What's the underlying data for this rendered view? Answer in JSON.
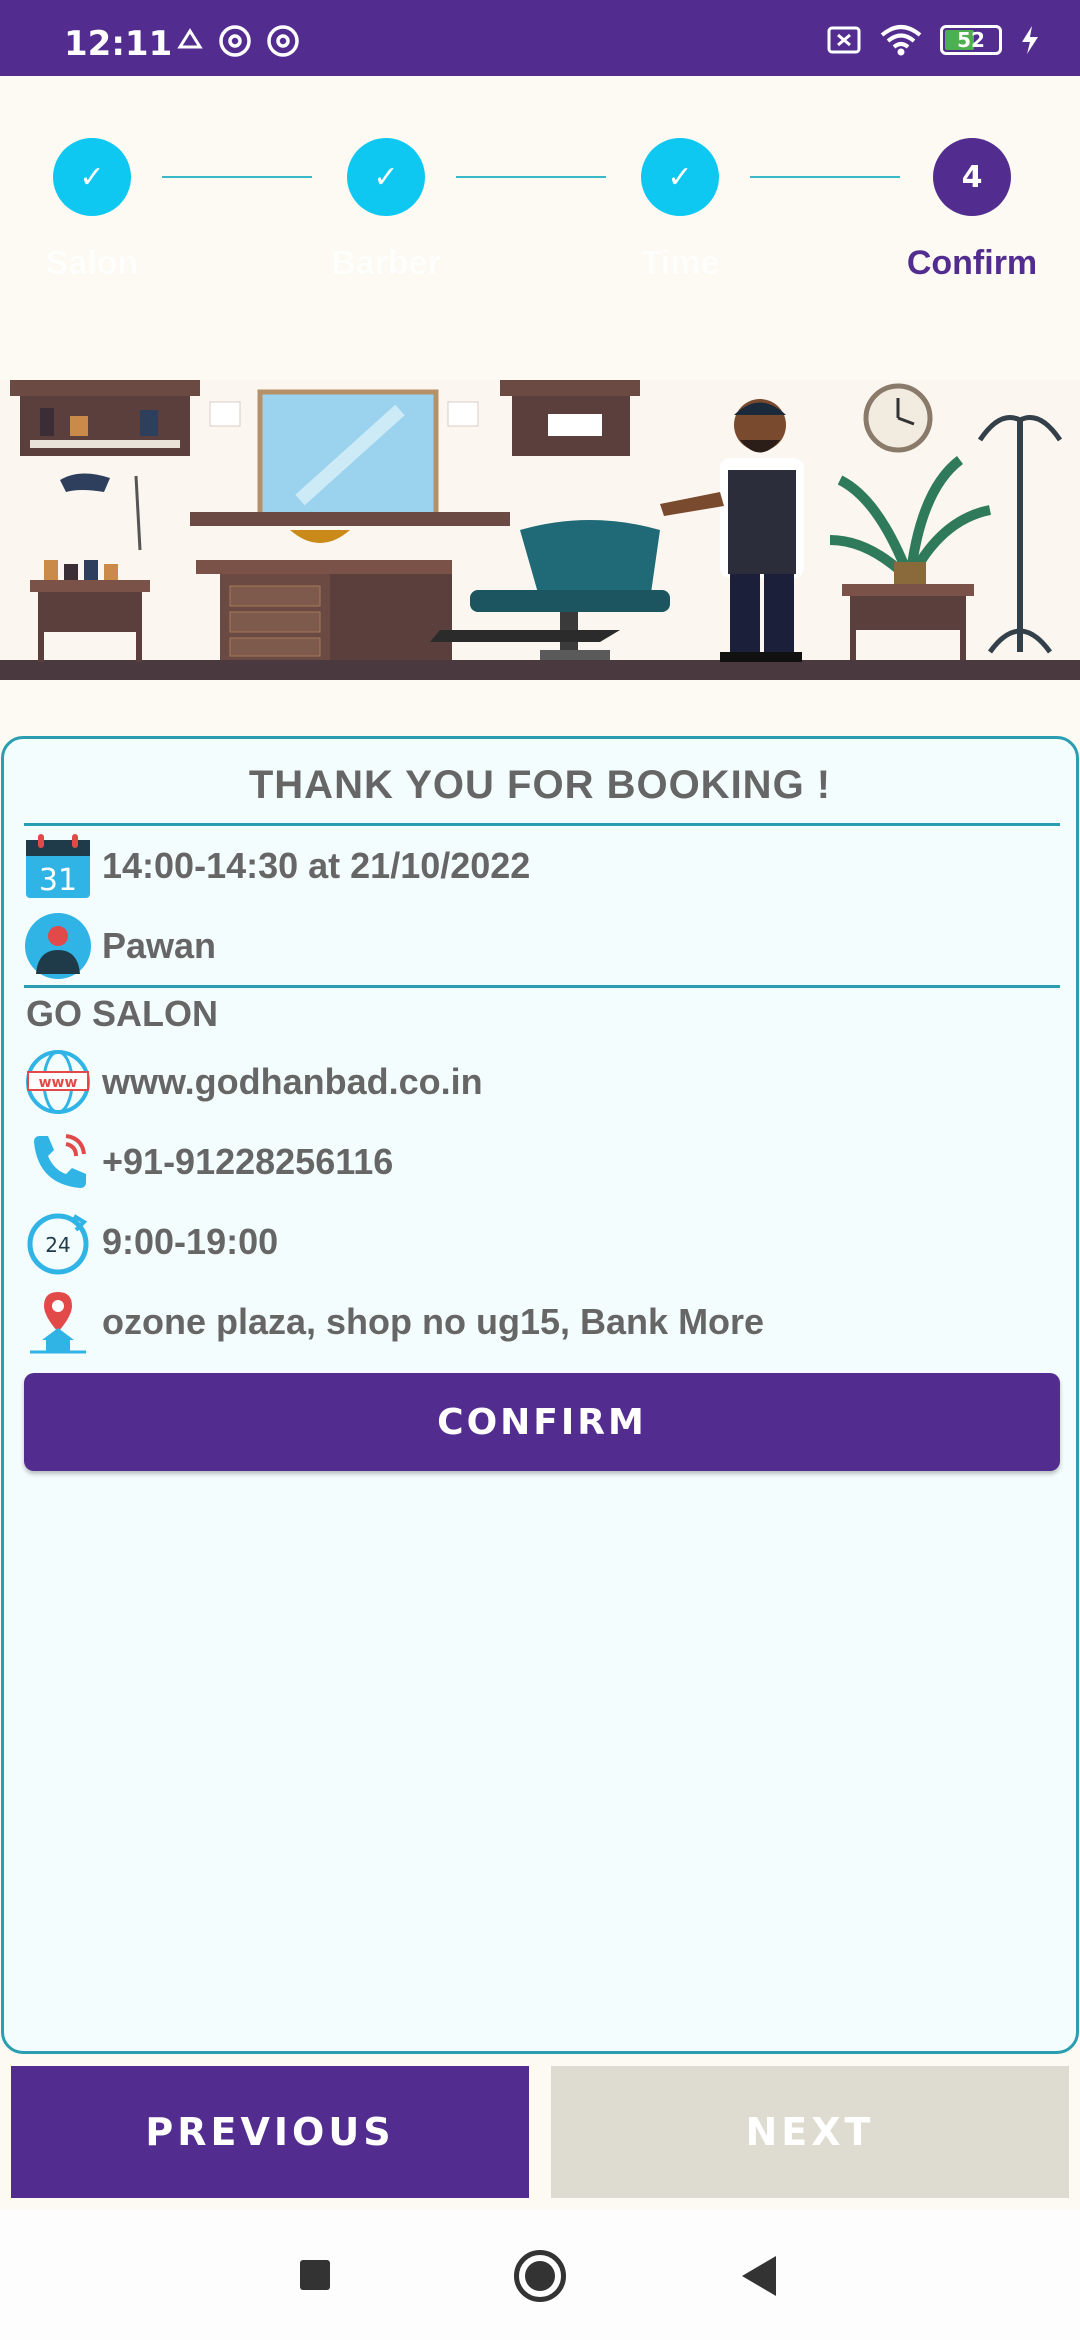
{
  "status_bar": {
    "time": "12:11",
    "battery": "52",
    "icons": [
      "app-notification-icon",
      "hotspot-icon",
      "hotspot-icon",
      "sim-off-icon",
      "wifi-icon",
      "battery-icon",
      "charging-icon"
    ]
  },
  "stepper": {
    "steps": [
      {
        "label": "Salon",
        "state": "done",
        "mark": "✓"
      },
      {
        "label": "Barber",
        "state": "done",
        "mark": "✓"
      },
      {
        "label": "Time",
        "state": "done",
        "mark": "✓"
      },
      {
        "label": "Confirm",
        "state": "active",
        "mark": "4"
      }
    ]
  },
  "card": {
    "title": "THANK YOU FOR BOOKING !",
    "booking_time": "14:00-14:30 at 21/10/2022",
    "calendar_day": "31",
    "barber_name": "Pawan",
    "salon_name": "GO SALON",
    "website": "www.godhanbad.co.in",
    "website_icon_text": "www",
    "phone": "+91-91228256116",
    "hours": "9:00-19:00",
    "hours_icon_text": "24",
    "address": "ozone plaza, shop no ug15, Bank More",
    "confirm_label": "CONFIRM"
  },
  "nav": {
    "previous_label": "PREVIOUS",
    "next_label": "NEXT"
  },
  "colors": {
    "primary": "#522d8f",
    "step_done": "#0fc8f2",
    "accent": "#2a9eb0",
    "disabled": "#dedbd0"
  }
}
